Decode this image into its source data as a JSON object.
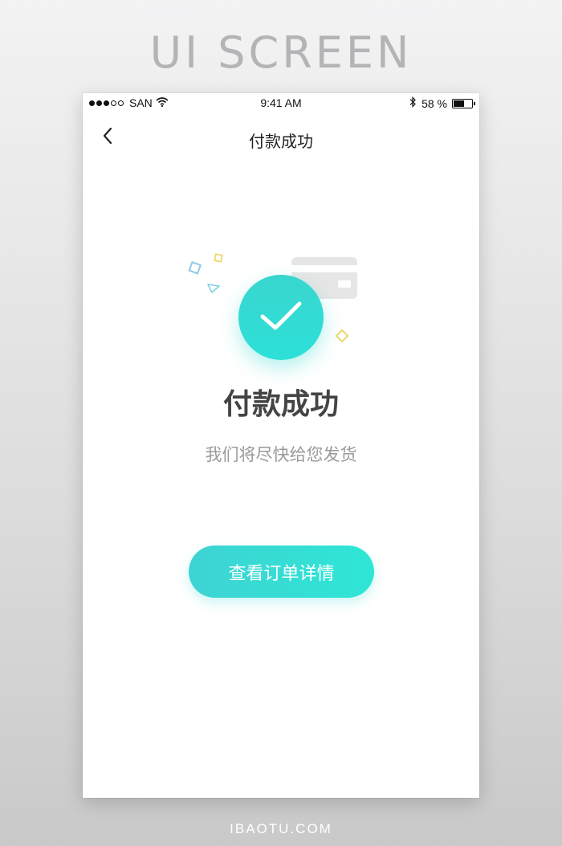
{
  "banner": {
    "title": "UI SCREEN"
  },
  "footer": {
    "brand": "IBAOTU.COM"
  },
  "status_bar": {
    "carrier": "SAN",
    "time": "9:41 AM",
    "battery_percent": "58 %",
    "battery_level": 0.58,
    "signal_bars_filled": 3,
    "signal_bars_total": 5
  },
  "nav": {
    "back_icon": "chevron-left-icon",
    "title": "付款成功"
  },
  "result": {
    "title": "付款成功",
    "message": "我们将尽快给您发货",
    "icon": "check-icon"
  },
  "actions": {
    "order_details_label": "查看订单详情"
  },
  "colors": {
    "accent": "#2cdcd4",
    "accent_light": "#3ed3d3",
    "title_text": "#444444",
    "secondary_text": "#9a9a9a"
  }
}
